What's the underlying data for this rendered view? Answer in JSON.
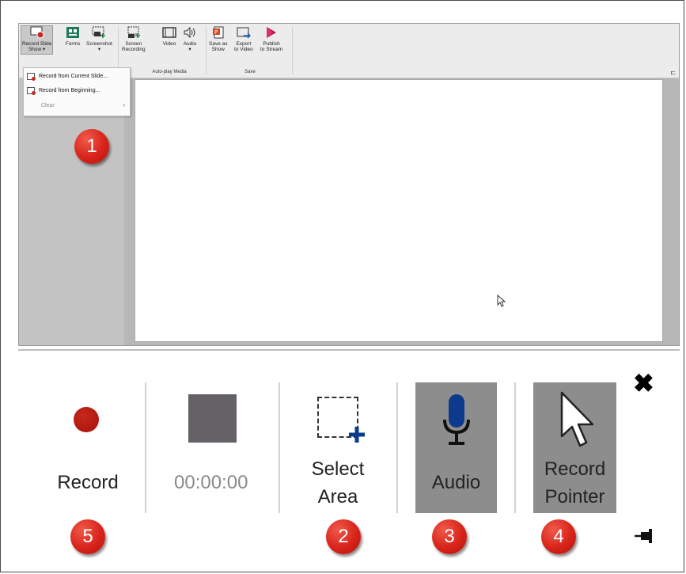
{
  "ribbon": {
    "buttons": [
      {
        "label1": "Record Slide",
        "label2": "Show ▾"
      },
      {
        "label1": "Forms",
        "label2": ""
      },
      {
        "label1": "Screenshot",
        "label2": "▾"
      },
      {
        "label1": "Screen",
        "label2": "Recording"
      },
      {
        "label1": "Video",
        "label2": ""
      },
      {
        "label1": "Audio",
        "label2": "▾"
      },
      {
        "label1": "Save as",
        "label2": "Show"
      },
      {
        "label1": "Export",
        "label2": "to Video"
      },
      {
        "label1": "Publish",
        "label2": "to Stream"
      }
    ],
    "groups": [
      "Auto-play Media",
      "Save"
    ],
    "pin": "⊏"
  },
  "dropdown": {
    "items": [
      "Record from Current Slide...",
      "Record from Beginning..."
    ],
    "clear_label": "Clear",
    "clear_arrow": "›"
  },
  "markers": [
    "1",
    "2",
    "3",
    "4",
    "5"
  ],
  "toolbar": {
    "record_label": "Record",
    "timer": "00:00:00",
    "select_area_line1": "Select",
    "select_area_line2": "Area",
    "audio_label": "Audio",
    "record_pointer_line1": "Record",
    "record_pointer_line2": "Pointer",
    "close_symbol": "✖"
  },
  "colors": {
    "marker_red": "#d8231a",
    "record_dot": "#a5140b",
    "stop_square": "#646167",
    "toggle_active_bg": "#8d8d8d",
    "mic_blue": "#0d3a8c",
    "plus_blue": "#0d3a8c"
  }
}
